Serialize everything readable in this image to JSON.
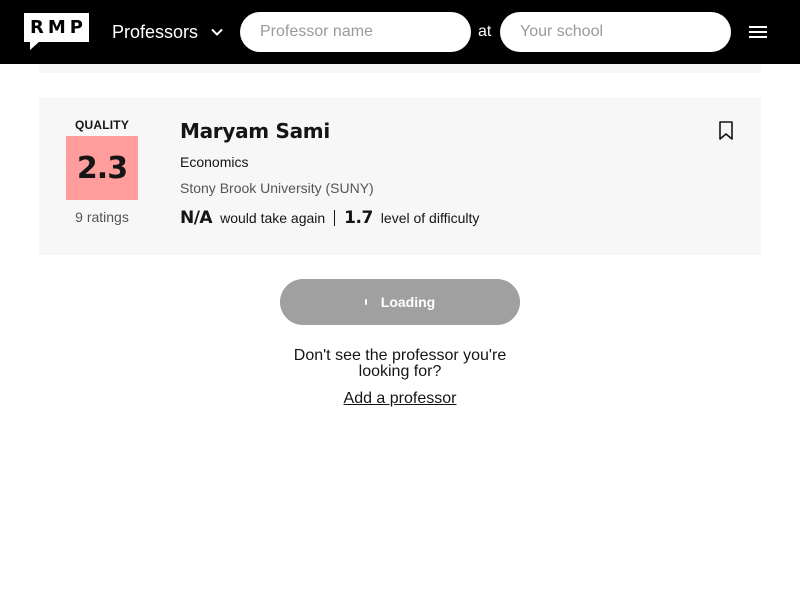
{
  "header": {
    "logo_text": "RMP",
    "type_select": "Professors",
    "professor_search": {
      "placeholder": "Professor name",
      "value": ""
    },
    "at_label": "at",
    "school_search": {
      "placeholder": "Your school",
      "value": ""
    }
  },
  "card": {
    "quality_label": "QUALITY",
    "quality_score": "2.3",
    "quality_color": "#ff9c9c",
    "ratings": "9 ratings",
    "name": "Maryam Sami",
    "department": "Economics",
    "school": "Stony Brook University (SUNY)",
    "would_take_again_value": "N/A",
    "would_take_again_label": "would take again",
    "difficulty_value": "1.7",
    "difficulty_label": "level of difficulty"
  },
  "loading": {
    "label": "Loading"
  },
  "footer": {
    "missing_text": "Don't see the professor you're looking for?",
    "add_link": "Add a professor"
  }
}
